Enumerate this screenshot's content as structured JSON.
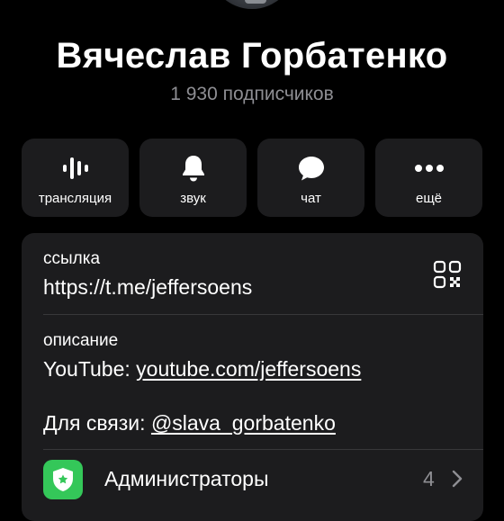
{
  "profile": {
    "name": "Вячеслав Горбатенко",
    "subscribers": "1 930 подписчиков"
  },
  "actions": [
    {
      "label": "трансляция",
      "icon": "waveform-icon"
    },
    {
      "label": "звук",
      "icon": "bell-icon"
    },
    {
      "label": "чат",
      "icon": "chat-bubble-icon"
    },
    {
      "label": "ещё",
      "icon": "more-dots-icon"
    }
  ],
  "info": {
    "link_label": "ссылка",
    "link_value": "https://t.me/jeffersoens",
    "description_label": "описание",
    "youtube_prefix": "YouTube: ",
    "youtube_link": "youtube.com/jeffersoens",
    "contact_prefix": "Для связи: ",
    "contact_link": "@slava_gorbatenko"
  },
  "admins": {
    "label": "Администраторы",
    "count": "4",
    "icon_color": "#34c759"
  },
  "colors": {
    "background": "#000000",
    "card": "#1c1c1e",
    "secondary_text": "#8e8e93",
    "separator": "#38383a"
  }
}
